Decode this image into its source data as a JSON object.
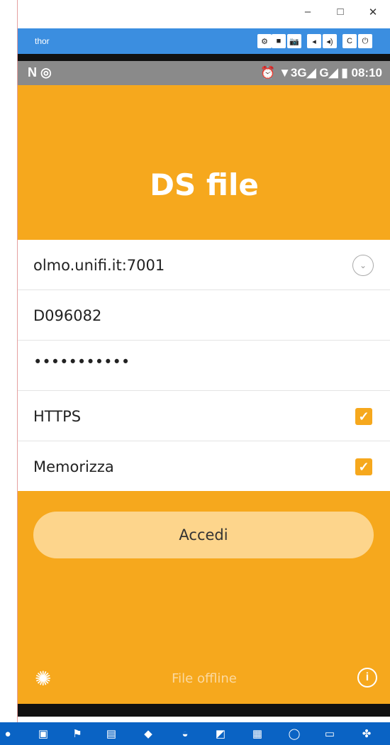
{
  "window": {
    "minimize_glyph": "–",
    "maximize_glyph": "□",
    "close_glyph": "✕"
  },
  "emulator": {
    "name": "thor",
    "buttons": [
      "⚙",
      "■",
      "📷",
      "◂",
      "◂)",
      "C",
      "⏻"
    ]
  },
  "status_bar": {
    "left": "N ◎",
    "right": "⏰ ▼3G◢ G◢ ▮ 08:10"
  },
  "app": {
    "title": "DS file",
    "server": "olmo.unifi.it:7001",
    "username": "D096082",
    "password": "•••••••••••",
    "https_label": "HTTPS",
    "https_checked": true,
    "remember_label": "Memorizza",
    "remember_checked": true,
    "checkmark": "✓",
    "chevron": "⌄",
    "login_label": "Accedi",
    "offline_label": "File offline",
    "settings_icon": "gear-icon",
    "info_icon": "info-icon",
    "info_glyph": "i",
    "settings_glyph": "✺"
  },
  "colors": {
    "accent": "#f6a81d",
    "button": "#fdd58c",
    "emulator_bar": "#3b8ee0",
    "taskbar": "#0a63c4"
  },
  "taskbar": {
    "icons": [
      "●",
      "▣",
      "⚑",
      "▤",
      "◆",
      "◒",
      "◩",
      "▦",
      "◯",
      "▭",
      "✤"
    ]
  }
}
